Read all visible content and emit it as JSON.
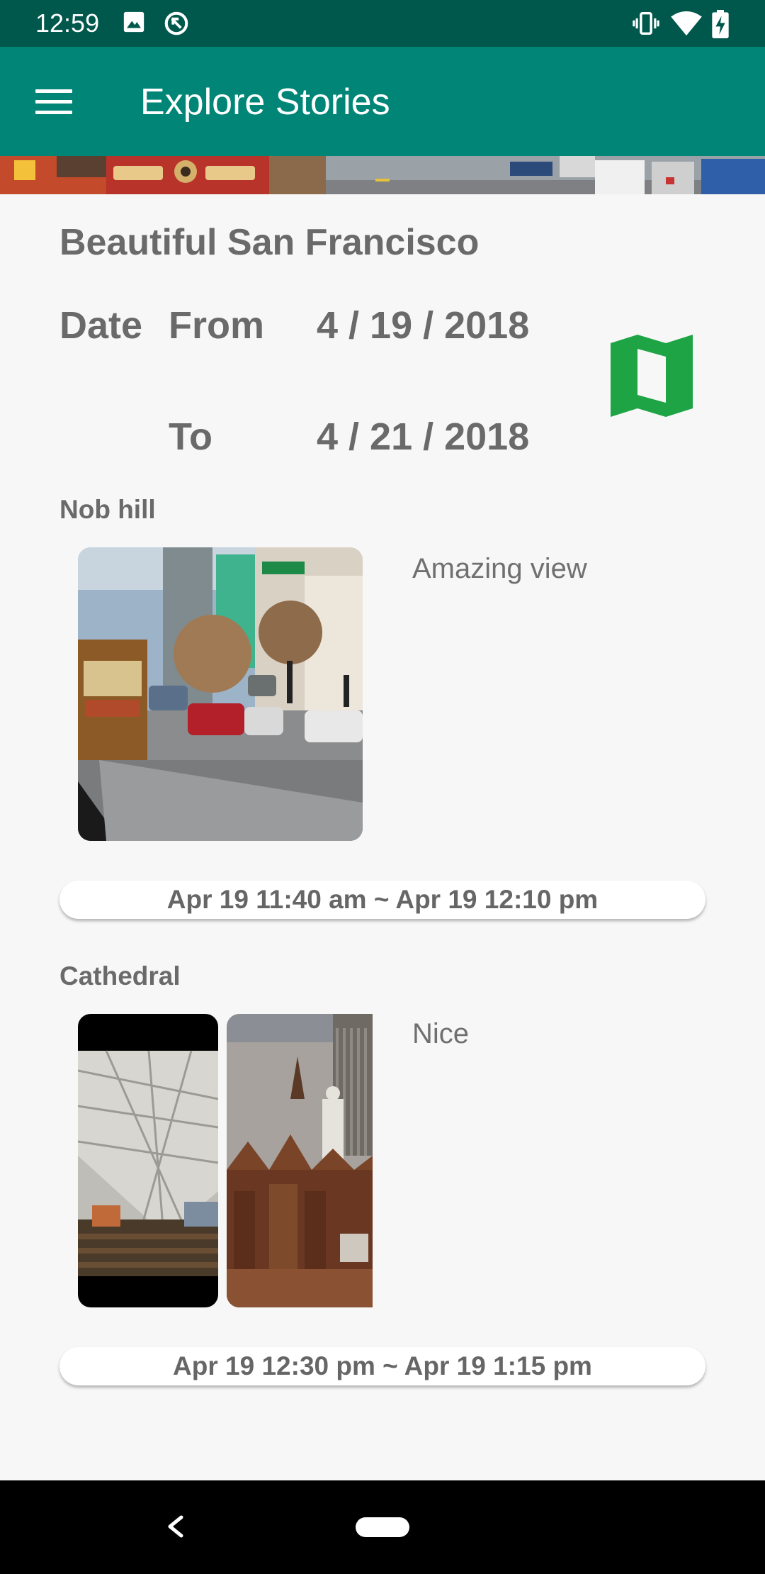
{
  "status_bar": {
    "time": "12:59",
    "icons": [
      "image-icon",
      "sync-icon",
      "vibrate-icon",
      "wifi-icon",
      "battery-charging-icon"
    ]
  },
  "app_bar": {
    "menu_icon": "hamburger-menu-icon",
    "title": "Explore Stories",
    "color": "#008577"
  },
  "story": {
    "title": "Beautiful San Francisco",
    "date_label": "Date",
    "from_label": "From",
    "from_value": "4 / 19 / 2018",
    "to_label": "To",
    "to_value": "4 / 21 / 2018",
    "map_icon": "map-icon",
    "map_color": "#1ea445"
  },
  "places": [
    {
      "name": "Nob hill",
      "note": "Amazing view",
      "time_range": "Apr 19 11:40 am ~ Apr 19 12:10 pm"
    },
    {
      "name": "Cathedral",
      "note": "Nice",
      "time_range": "Apr 19 12:30 pm ~ Apr 19 1:15 pm"
    }
  ],
  "nav_bar": {
    "back_icon": "back-chevron-icon",
    "home_icon": "home-pill-icon"
  }
}
